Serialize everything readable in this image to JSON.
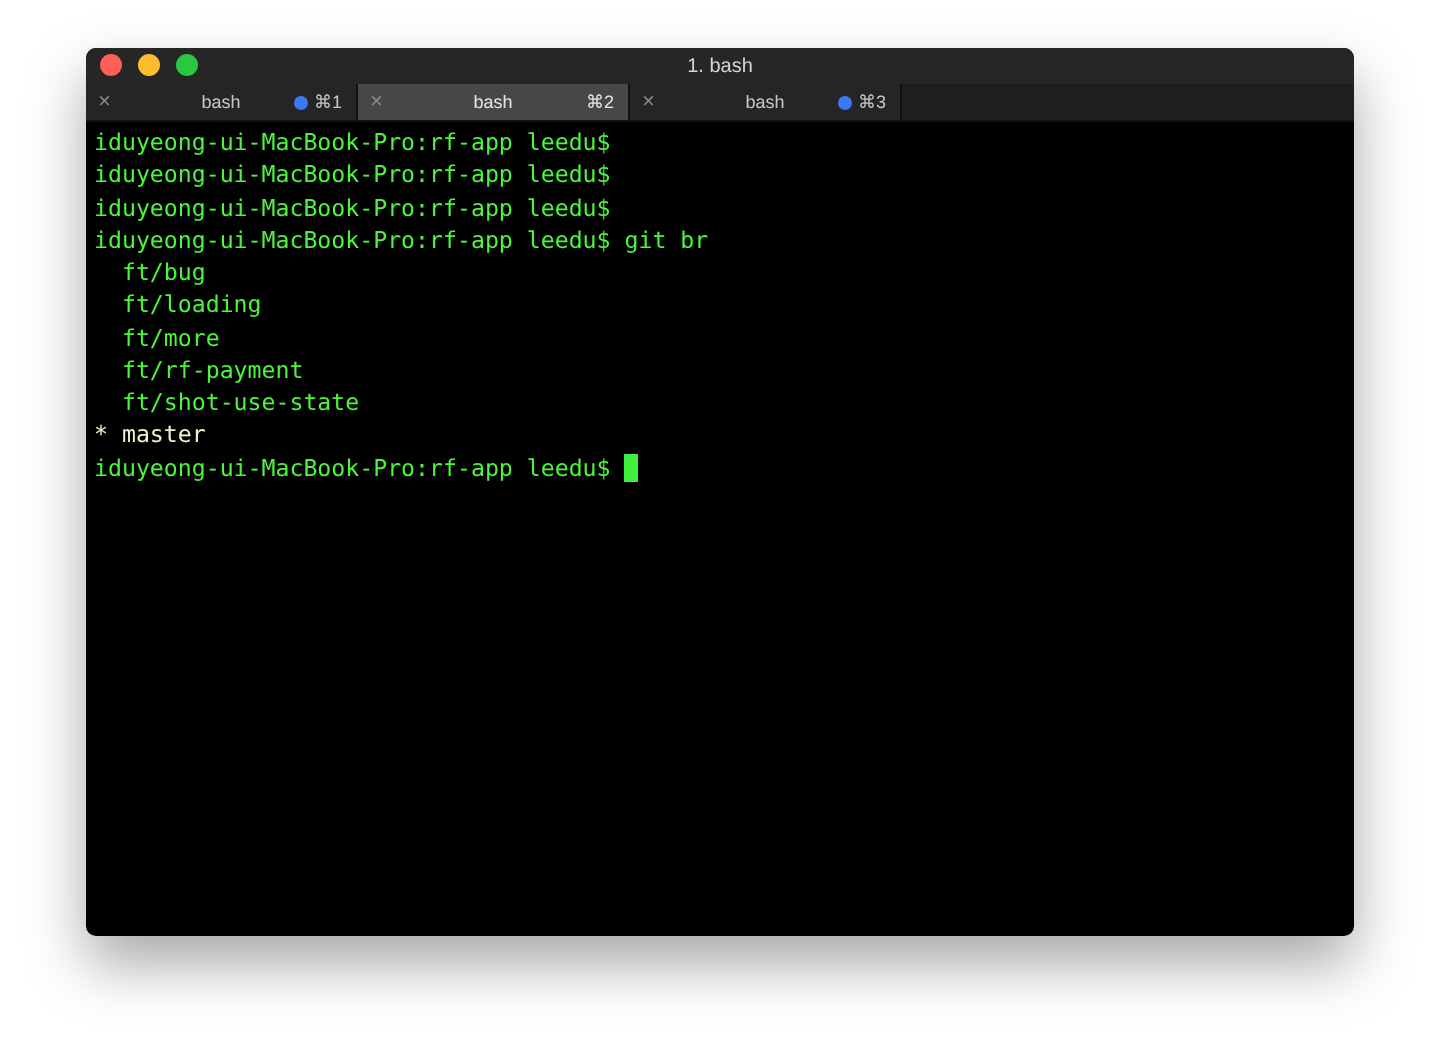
{
  "window": {
    "title": "1. bash"
  },
  "tabs": [
    {
      "close": "×",
      "label": "bash",
      "activity": true,
      "shortcut": "⌘1",
      "selected": false
    },
    {
      "close": "×",
      "label": "bash",
      "activity": false,
      "shortcut": "⌘2",
      "selected": true
    },
    {
      "close": "×",
      "label": "bash",
      "activity": true,
      "shortcut": "⌘3",
      "selected": false
    }
  ],
  "terminal": {
    "lines": [
      {
        "kind": "prompt",
        "text": "iduyeong-ui-MacBook-Pro:rf-app leedu$"
      },
      {
        "kind": "prompt",
        "text": "iduyeong-ui-MacBook-Pro:rf-app leedu$"
      },
      {
        "kind": "prompt",
        "text": "iduyeong-ui-MacBook-Pro:rf-app leedu$"
      },
      {
        "kind": "prompt",
        "text": "iduyeong-ui-MacBook-Pro:rf-app leedu$ git br"
      },
      {
        "kind": "branch",
        "text": "  ft/bug"
      },
      {
        "kind": "branch",
        "text": "  ft/loading"
      },
      {
        "kind": "branch",
        "text": "  ft/more"
      },
      {
        "kind": "branch",
        "text": "  ft/rf-payment"
      },
      {
        "kind": "branch",
        "text": "  ft/shot-use-state"
      },
      {
        "kind": "current",
        "text": "* master"
      },
      {
        "kind": "prompt",
        "text": "iduyeong-ui-MacBook-Pro:rf-app leedu$",
        "cursor": true
      }
    ]
  }
}
